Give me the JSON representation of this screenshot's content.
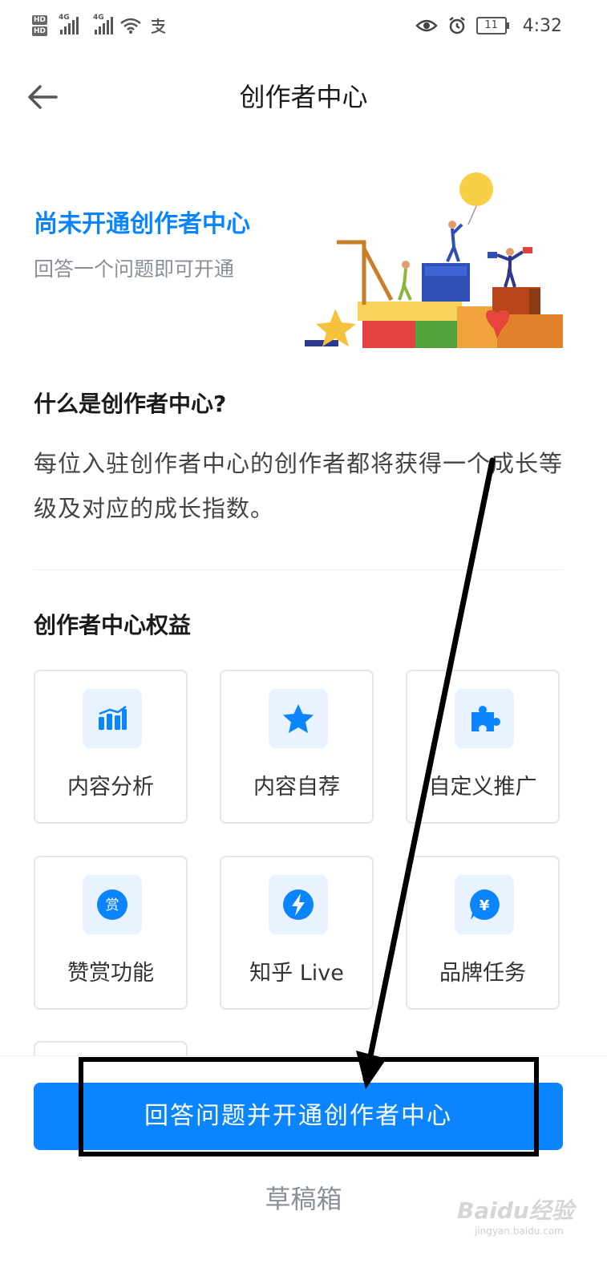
{
  "status_bar": {
    "hd1": "HD",
    "hd2": "HD",
    "net1": "4G",
    "net2": "4G",
    "pay_icon": "alipay-icon",
    "battery": "11",
    "time": "4:32"
  },
  "header": {
    "title": "创作者中心",
    "back_icon": "arrow-left-icon"
  },
  "hero": {
    "title": "尚未开通创作者中心",
    "subtitle": "回答一个问题即可开通",
    "accent": "#0a84ff"
  },
  "what": {
    "title": "什么是创作者中心?",
    "body": "每位入驻创作者中心的创作者都将获得一个成长等级及对应的成长指数。"
  },
  "benefits": {
    "title": "创作者中心权益",
    "items": [
      {
        "label": "内容分析",
        "icon": "bar-chart-icon"
      },
      {
        "label": "内容自荐",
        "icon": "star-icon"
      },
      {
        "label": "自定义推广",
        "icon": "puzzle-icon"
      },
      {
        "label": "赞赏功能",
        "icon": "reward-icon"
      },
      {
        "label": "知乎 Live",
        "icon": "lightning-icon"
      },
      {
        "label": "品牌任务",
        "icon": "yen-icon"
      }
    ]
  },
  "actions": {
    "primary": "回答问题并开通创作者中心",
    "secondary": "草稿箱"
  },
  "watermark": {
    "text": "Baidu经验",
    "sub": "jingyan.baidu.com"
  },
  "colors": {
    "primary": "#0a84ff",
    "icon_bg": "#e9f3ff",
    "muted": "#8a8f99"
  }
}
